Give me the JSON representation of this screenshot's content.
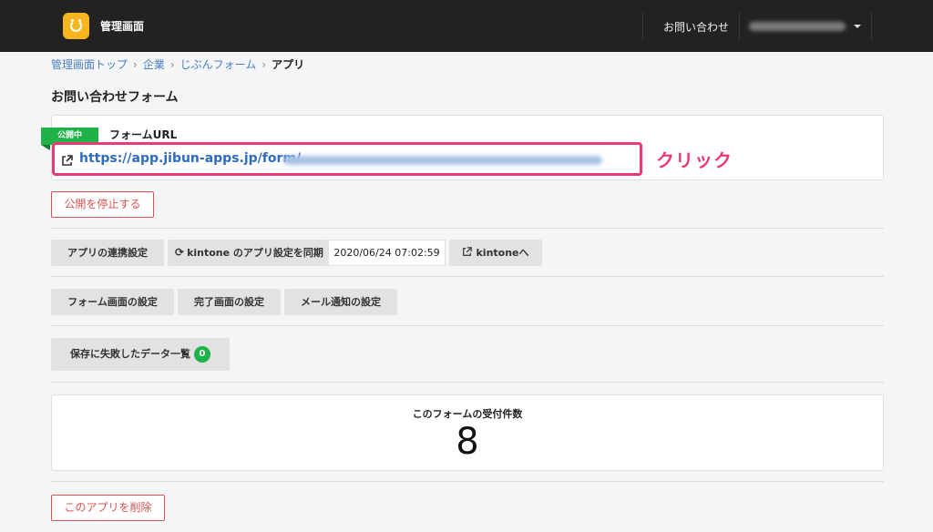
{
  "header": {
    "brand": "管理画面",
    "contact_link": "お問い合わせ"
  },
  "breadcrumb": {
    "items": [
      "管理画面トップ",
      "企業",
      "じぶんフォーム"
    ],
    "current": "アプリ"
  },
  "page": {
    "title": "お問い合わせフォーム"
  },
  "url_section": {
    "status_badge": "公開中",
    "label": "フォームURL",
    "url_visible": "https://app.jibun-apps.jp/form/",
    "annotation": "クリック"
  },
  "buttons": {
    "stop_publish": "公開を停止する",
    "app_link_settings": "アプリの連携設定",
    "sync_kintone": "kintone のアプリ設定を同期",
    "last_synced": "2020/06/24 07:02:59",
    "to_kintone": "kintoneへ",
    "form_screen_settings": "フォーム画面の設定",
    "complete_screen_settings": "完了画面の設定",
    "mail_notification_settings": "メール通知の設定",
    "failed_data_list": "保存に失敗したデータ一覧",
    "failed_count": "0",
    "delete_app": "このアプリを削除"
  },
  "stats": {
    "received_label": "このフォームの受付件数",
    "received_count": "8"
  },
  "colors": {
    "topbar": "#222222",
    "accent_green": "#1fb347",
    "danger": "#d9534f",
    "link": "#2d6cc1",
    "highlight": "#e83a78",
    "logo": "#f6b51e"
  }
}
